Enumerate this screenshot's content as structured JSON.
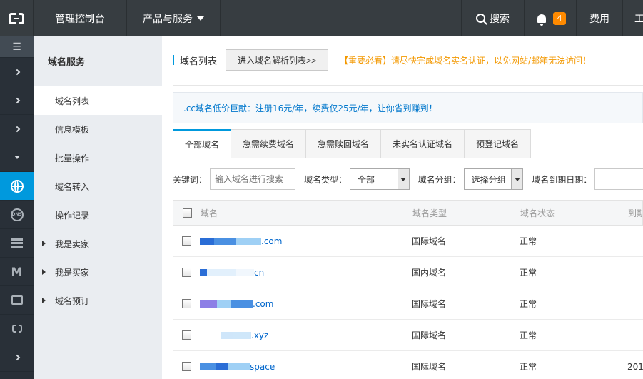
{
  "topbar": {
    "console_label": "管理控制台",
    "products_label": "产品与服务",
    "search_label": "搜索",
    "notification_count": "4",
    "fee_label": "费用",
    "cut_label": "工"
  },
  "iconbar": {
    "menu_glyph": "☰"
  },
  "sidebar": {
    "title": "域名服务",
    "items": [
      {
        "label": "域名列表"
      },
      {
        "label": "信息模板"
      },
      {
        "label": "批量操作"
      },
      {
        "label": "域名转入"
      },
      {
        "label": "操作记录"
      }
    ],
    "groups": [
      {
        "label": "我是卖家"
      },
      {
        "label": "我是买家"
      },
      {
        "label": "域名预订"
      }
    ]
  },
  "main": {
    "page_title": "域名列表",
    "enter_dns_button": "进入域名解析列表>>",
    "notice": "【重要必看】请尽快完成域名实名认证，以免网站/邮箱无法访问！",
    "promo": ".cc域名低价巨献：注册16元/年，续费仅25元/年，让你省到赚到！",
    "tabs": [
      {
        "label": "全部域名"
      },
      {
        "label": "急需续费域名"
      },
      {
        "label": "急需赎回域名"
      },
      {
        "label": "未实名认证域名"
      },
      {
        "label": "预登记域名"
      }
    ],
    "filters": {
      "keyword_label": "关键词：",
      "keyword_placeholder": "输入域名进行搜索",
      "type_label": "域名类型：",
      "type_value": "全部",
      "group_label": "域名分组：",
      "group_value": "选择分组",
      "expire_label": "域名到期日期："
    },
    "table": {
      "headers": {
        "name": "域名",
        "type": "域名类型",
        "status": "域名状态",
        "date": "到期"
      },
      "rows": [
        {
          "suffix": ".com",
          "type": "国际域名",
          "status": "正常",
          "date": ""
        },
        {
          "suffix": "cn",
          "type": "国内域名",
          "status": "正常",
          "date": ""
        },
        {
          "suffix": ".com",
          "type": "国际域名",
          "status": "正常",
          "date": ""
        },
        {
          "suffix": ".xyz",
          "type": "国际域名",
          "status": "正常",
          "date": ""
        },
        {
          "suffix": "space",
          "type": "国际域名",
          "status": "正常",
          "date": "201"
        }
      ]
    }
  },
  "colors": {
    "topbar_bg": "#373d41",
    "accent": "#0099dd",
    "notice": "#f39800",
    "badge": "#ff8a00",
    "link": "#0066cc"
  }
}
